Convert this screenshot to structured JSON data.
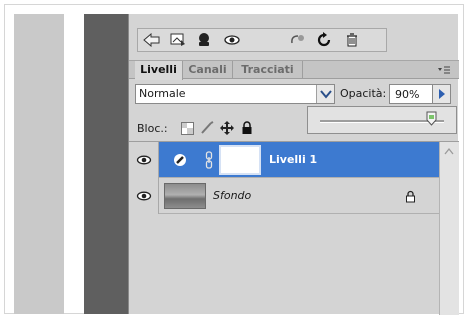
{
  "tabs": [
    "Livelli",
    "Canali",
    "Tracciati"
  ],
  "blend_mode": "Normale",
  "opacity": {
    "label": "Opacità:",
    "value": "90%",
    "slider_fraction": 0.9
  },
  "lock_label": "Bloc.:",
  "layers": [
    {
      "name": "Livelli 1",
      "selected": true
    },
    {
      "name": "Sfondo",
      "selected": false
    }
  ],
  "colors": {
    "selection": "#3d7ad0",
    "panel": "#d4d4d4"
  }
}
